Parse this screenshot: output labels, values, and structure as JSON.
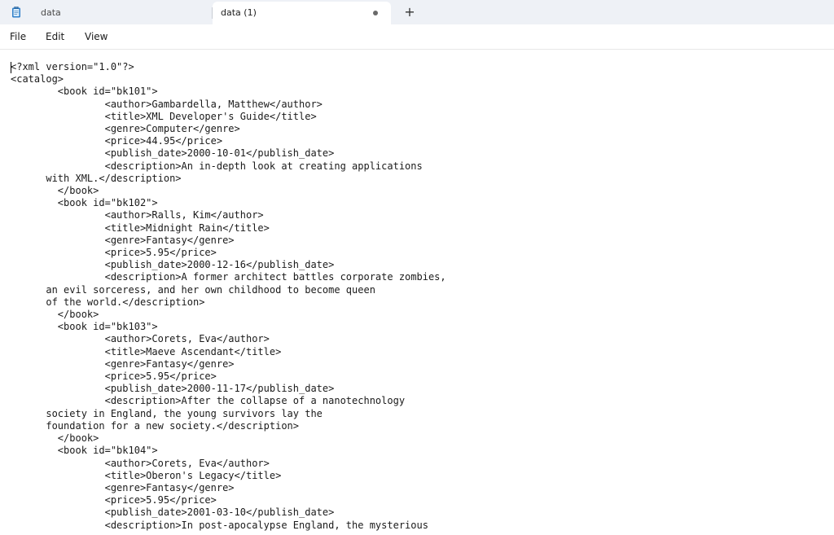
{
  "tabs": [
    {
      "label": "data",
      "active": false
    },
    {
      "label": "data (1)",
      "active": true,
      "unsaved": true
    }
  ],
  "new_tab_label": "+",
  "menu": {
    "file": "File",
    "edit": "Edit",
    "view": "View"
  },
  "editor": {
    "content": "<?xml version=\"1.0\"?>\n<catalog>\n        <book id=\"bk101\">\n                <author>Gambardella, Matthew</author>\n                <title>XML Developer's Guide</title>\n                <genre>Computer</genre>\n                <price>44.95</price>\n                <publish_date>2000-10-01</publish_date>\n                <description>An in-depth look at creating applications\n      with XML.</description>\n        </book>\n        <book id=\"bk102\">\n                <author>Ralls, Kim</author>\n                <title>Midnight Rain</title>\n                <genre>Fantasy</genre>\n                <price>5.95</price>\n                <publish_date>2000-12-16</publish_date>\n                <description>A former architect battles corporate zombies,\n      an evil sorceress, and her own childhood to become queen\n      of the world.</description>\n        </book>\n        <book id=\"bk103\">\n                <author>Corets, Eva</author>\n                <title>Maeve Ascendant</title>\n                <genre>Fantasy</genre>\n                <price>5.95</price>\n                <publish_date>2000-11-17</publish_date>\n                <description>After the collapse of a nanotechnology\n      society in England, the young survivors lay the\n      foundation for a new society.</description>\n        </book>\n        <book id=\"bk104\">\n                <author>Corets, Eva</author>\n                <title>Oberon's Legacy</title>\n                <genre>Fantasy</genre>\n                <price>5.95</price>\n                <publish_date>2001-03-10</publish_date>\n                <description>In post-apocalypse England, the mysterious"
  },
  "colors": {
    "titlebar_bg": "#eef1f6",
    "active_tab_bg": "#ffffff",
    "text": "#1a1a1a"
  },
  "icons": {
    "app": "notepad-icon",
    "unsaved": "unsaved-dot-icon"
  }
}
